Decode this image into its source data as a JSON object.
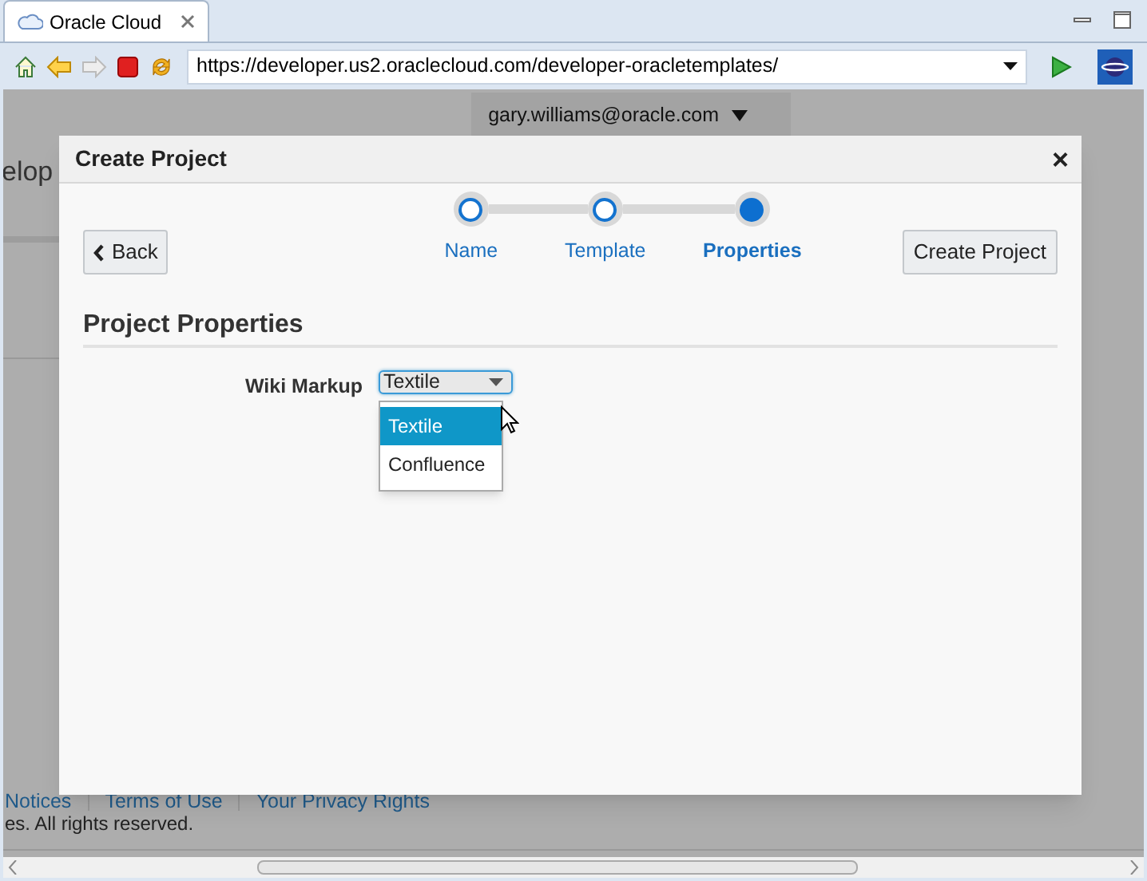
{
  "browser": {
    "tab_title": "Oracle Cloud",
    "url": "https://developer.us2.oraclecloud.com/developer-oracletemplates/"
  },
  "page": {
    "user_menu": "gary.williams@oracle.com",
    "heading_fragment": "elop",
    "footer_links": [
      "Notices",
      "Terms of Use",
      "Your Privacy Rights"
    ],
    "copyright": "es. All rights reserved."
  },
  "dialog": {
    "title": "Create Project",
    "close": "×",
    "back_button": "Back",
    "create_button": "Create Project",
    "steps": [
      {
        "label": "Name",
        "selected": false
      },
      {
        "label": "Template",
        "selected": false
      },
      {
        "label": "Properties",
        "selected": true
      }
    ],
    "section_title": "Project Properties",
    "field": {
      "label": "Wiki Markup",
      "value": "Textile",
      "expanded": true,
      "options": [
        {
          "label": "Textile",
          "selected": true
        },
        {
          "label": "Confluence",
          "selected": false
        }
      ]
    }
  }
}
